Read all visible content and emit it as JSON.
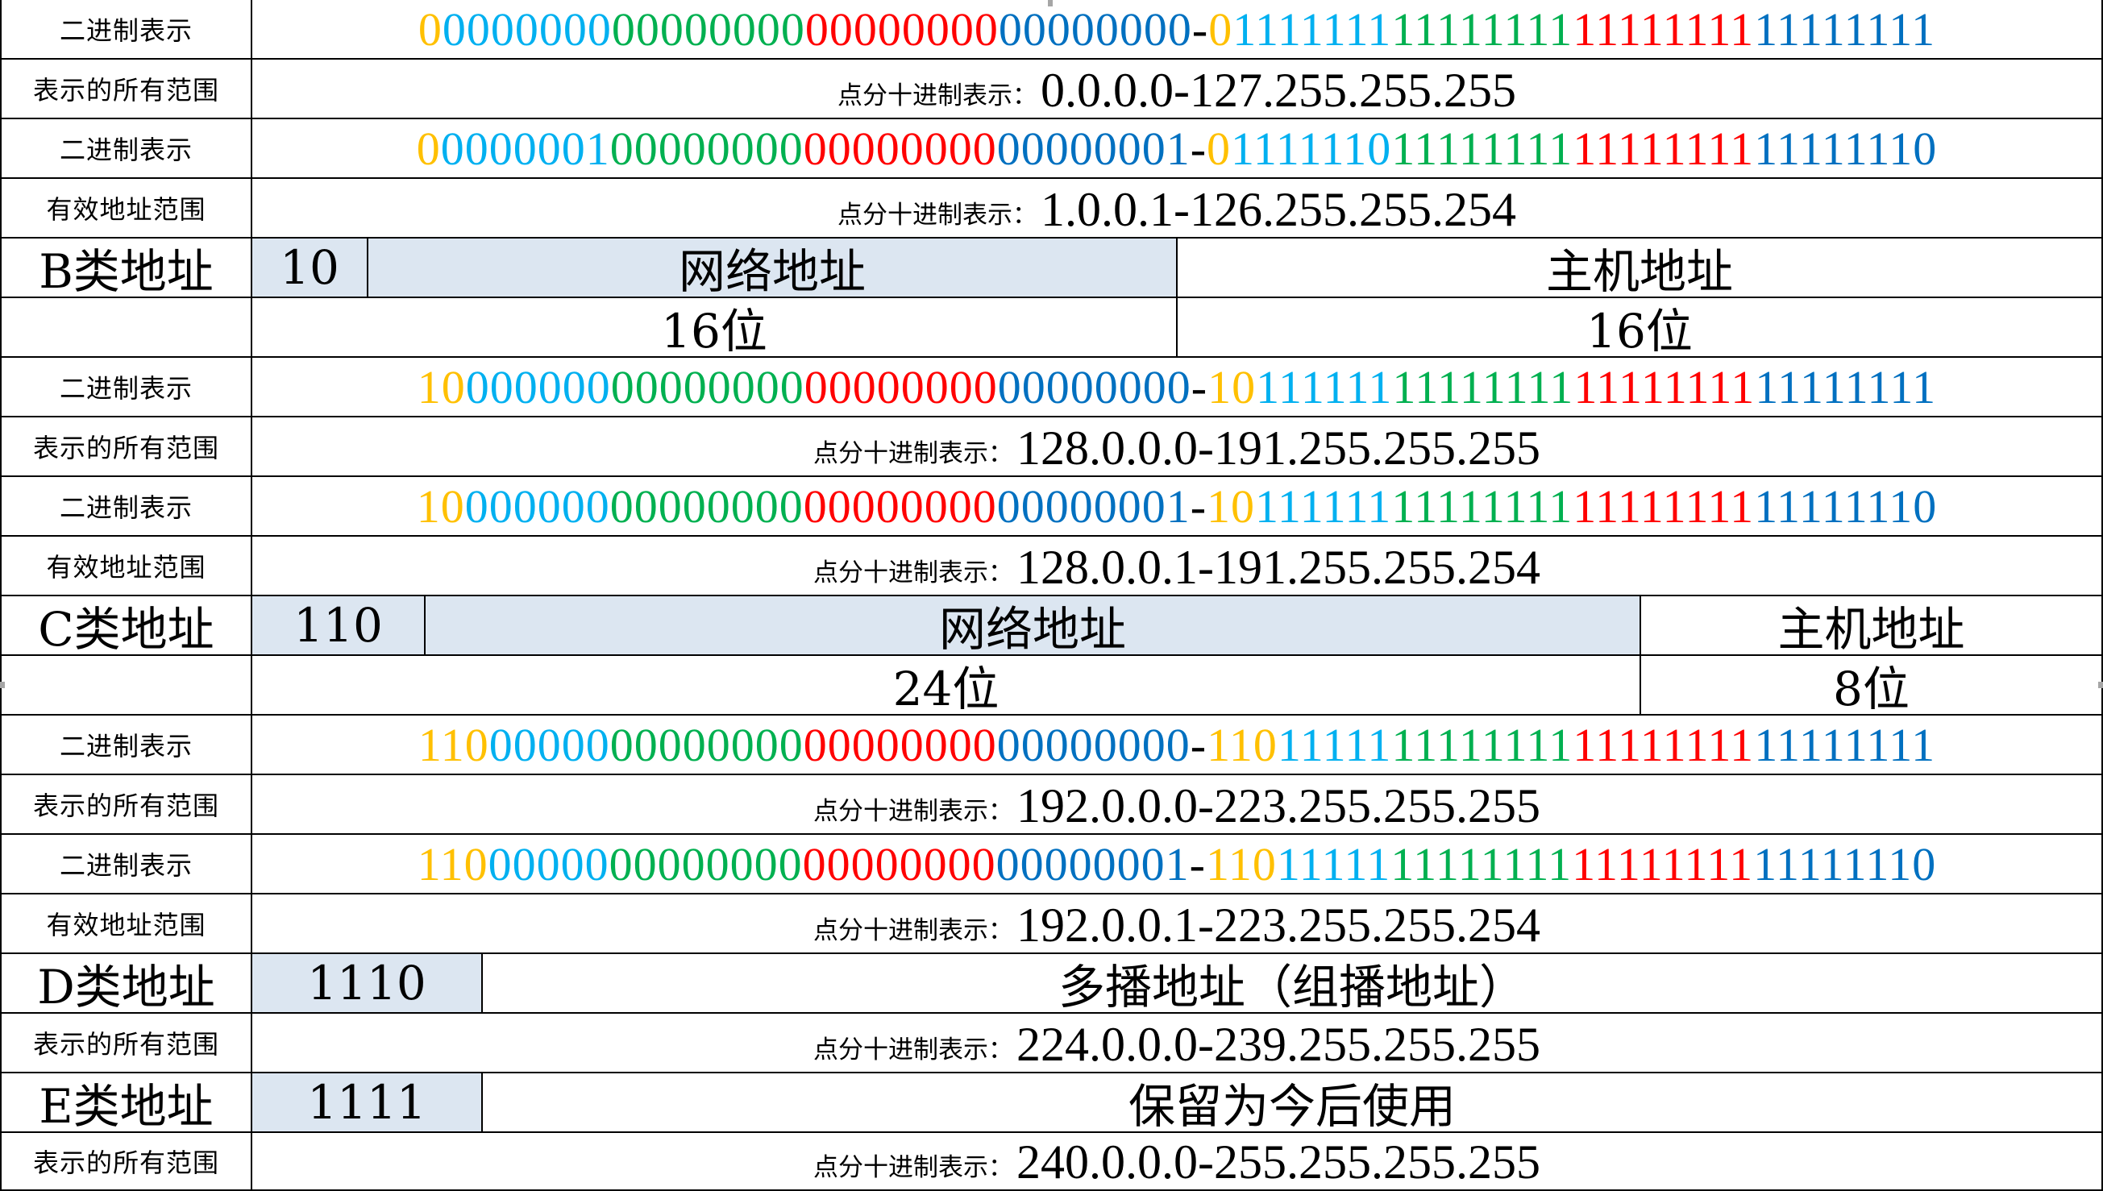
{
  "labels": {
    "binary": "二进制表示",
    "all_range": "表示的所有范围",
    "valid_range": "有效地址范围",
    "dotted_prefix": "点分十进制表示："
  },
  "class_a": {
    "bin_all": {
      "left": [
        "0",
        "0000000",
        "00000000",
        "00000000",
        "00000000"
      ],
      "right": [
        "0",
        "1111111",
        "11111111",
        "11111111",
        "11111111"
      ]
    },
    "all_range": "0.0.0.0-127.255.255.255",
    "bin_valid": {
      "left": [
        "0",
        "0000001",
        "00000000",
        "00000000",
        "00000001"
      ],
      "right": [
        "0",
        "1111110",
        "11111111",
        "11111111",
        "11111110"
      ]
    },
    "valid_range": "1.0.0.1-126.255.255.254"
  },
  "class_b": {
    "title": "B类地址",
    "prefix": "10",
    "network": "网络地址",
    "host": "主机地址",
    "network_bits": "16位",
    "host_bits": "16位",
    "bin_all": {
      "left": [
        "10",
        "000000",
        "00000000",
        "00000000",
        "00000000"
      ],
      "right": [
        "10",
        "111111",
        "11111111",
        "11111111",
        "11111111"
      ]
    },
    "all_range": "128.0.0.0-191.255.255.255",
    "bin_valid": {
      "left": [
        "10",
        "000000",
        "00000000",
        "00000000",
        "00000001"
      ],
      "right": [
        "10",
        "111111",
        "11111111",
        "11111111",
        "11111110"
      ]
    },
    "valid_range": "128.0.0.1-191.255.255.254"
  },
  "class_c": {
    "title": "C类地址",
    "prefix": "110",
    "network": "网络地址",
    "host": "主机地址",
    "network_bits": "24位",
    "host_bits": "8位",
    "bin_all": {
      "left": [
        "110",
        "00000",
        "00000000",
        "00000000",
        "00000000"
      ],
      "right": [
        "110",
        "11111",
        "11111111",
        "11111111",
        "11111111"
      ]
    },
    "all_range": "192.0.0.0-223.255.255.255",
    "bin_valid": {
      "left": [
        "110",
        "00000",
        "00000000",
        "00000000",
        "00000001"
      ],
      "right": [
        "110",
        "11111",
        "11111111",
        "11111111",
        "11111110"
      ]
    },
    "valid_range": "192.0.0.1-223.255.255.254"
  },
  "class_d": {
    "title": "D类地址",
    "prefix": "1110",
    "description": "多播地址（组播地址）",
    "all_range": "224.0.0.0-239.255.255.255"
  },
  "class_e": {
    "title": "E类地址",
    "prefix": "1111",
    "description": "保留为今后使用",
    "all_range": "240.0.0.0-255.255.255.255"
  },
  "colors": {
    "prefix": "#ffc000",
    "octet1": "#00b0f0",
    "octet2": "#00b050",
    "octet3": "#ff0000",
    "octet4": "#0070c0",
    "header_fill": "#dce6f1"
  }
}
